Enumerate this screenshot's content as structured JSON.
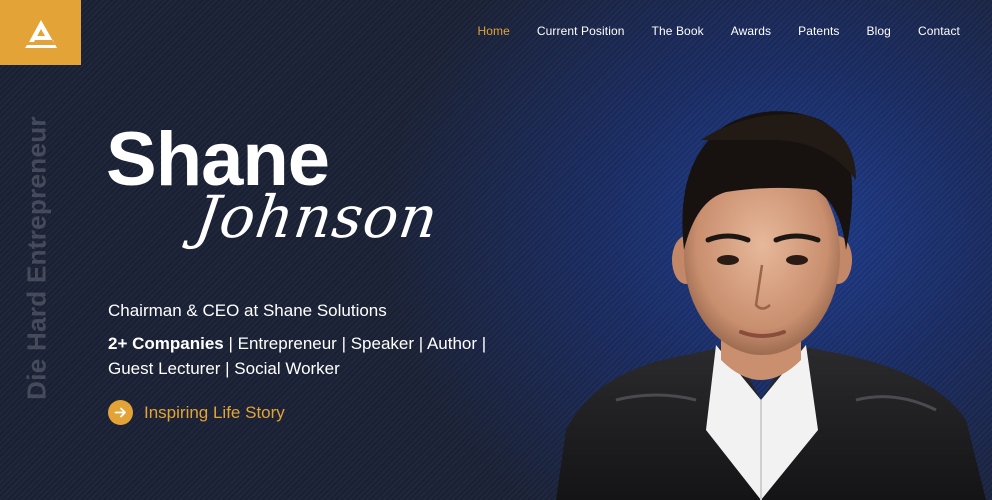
{
  "nav": {
    "items": [
      {
        "label": "Home",
        "active": true
      },
      {
        "label": "Current Position",
        "active": false
      },
      {
        "label": "The Book",
        "active": false
      },
      {
        "label": "Awards",
        "active": false
      },
      {
        "label": "Patents",
        "active": false
      },
      {
        "label": "Blog",
        "active": false
      },
      {
        "label": "Contact",
        "active": false
      }
    ]
  },
  "hero": {
    "vertical_text": "Die Hard Entrepreneur",
    "first_name": "Shane",
    "last_name": "Johnson",
    "role": "Chairman & CEO at Shane Solutions",
    "tags_bold": "2+ Companies",
    "tags_rest": " | Entrepreneur | Speaker | Author | Guest Lecturer | Social Worker",
    "cta_label": "Inspiring Life Story"
  },
  "colors": {
    "accent": "#e3a336",
    "background": "#1b2236",
    "glow": "#1f3d8f"
  },
  "icons": {
    "logo": "brand-logo-icon",
    "cta": "arrow-right-icon"
  }
}
